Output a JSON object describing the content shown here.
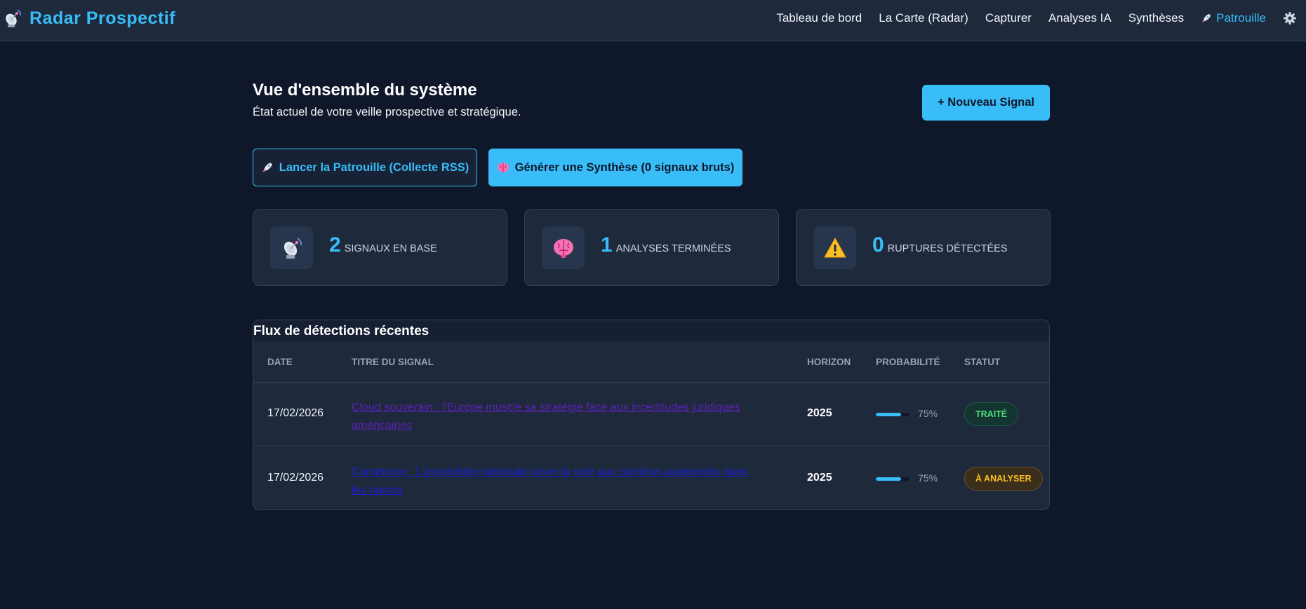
{
  "nav": {
    "brand": "Radar Prospectif",
    "links": [
      "Tableau de bord",
      "La Carte (Radar)",
      "Capturer",
      "Analyses IA",
      "Synthèses",
      "Patrouille"
    ],
    "active_link": "Patrouille"
  },
  "header": {
    "title": "Vue d'ensemble du système",
    "subtitle": "État actuel de votre veille prospective et stratégique.",
    "new_signal_button": "+ Nouveau Signal"
  },
  "actions": {
    "patrol_button": "Lancer la Patrouille (Collecte RSS)",
    "synthesis_button": "Générer une Synthèse (0 signaux bruts)"
  },
  "stats": [
    {
      "value": "2",
      "label": "signaux en base",
      "icon": "satellite-dish-icon"
    },
    {
      "value": "1",
      "label": "analyses terminées",
      "icon": "brain-icon"
    },
    {
      "value": "0",
      "label": "ruptures détectées",
      "icon": "warning-icon"
    }
  ],
  "table": {
    "title": "Flux de détections récentes",
    "columns": [
      "Date",
      "Titre du signal",
      "Horizon",
      "Probabilité",
      "Statut"
    ],
    "rows": [
      {
        "date": "17/02/2026",
        "title": "Cloud souverain : l'Europe muscle sa stratégie face aux incertitudes juridiques américaines",
        "horizon": "2025",
        "probability": 0.75,
        "probability_label": "75%",
        "status": "Traité"
      },
      {
        "date": "17/02/2026",
        "title": "Commerce : L'assemblée nationale ouvre la voie aux caméras augmentés dans les rayons",
        "horizon": "2025",
        "probability": 0.75,
        "probability_label": "75%",
        "status": "À analyser"
      }
    ]
  },
  "colors": {
    "background": "#0f172a",
    "surface": "#1e293b",
    "accent": "#38bdf8",
    "status_done": "#4ade80",
    "status_pending": "#fbbf24"
  }
}
